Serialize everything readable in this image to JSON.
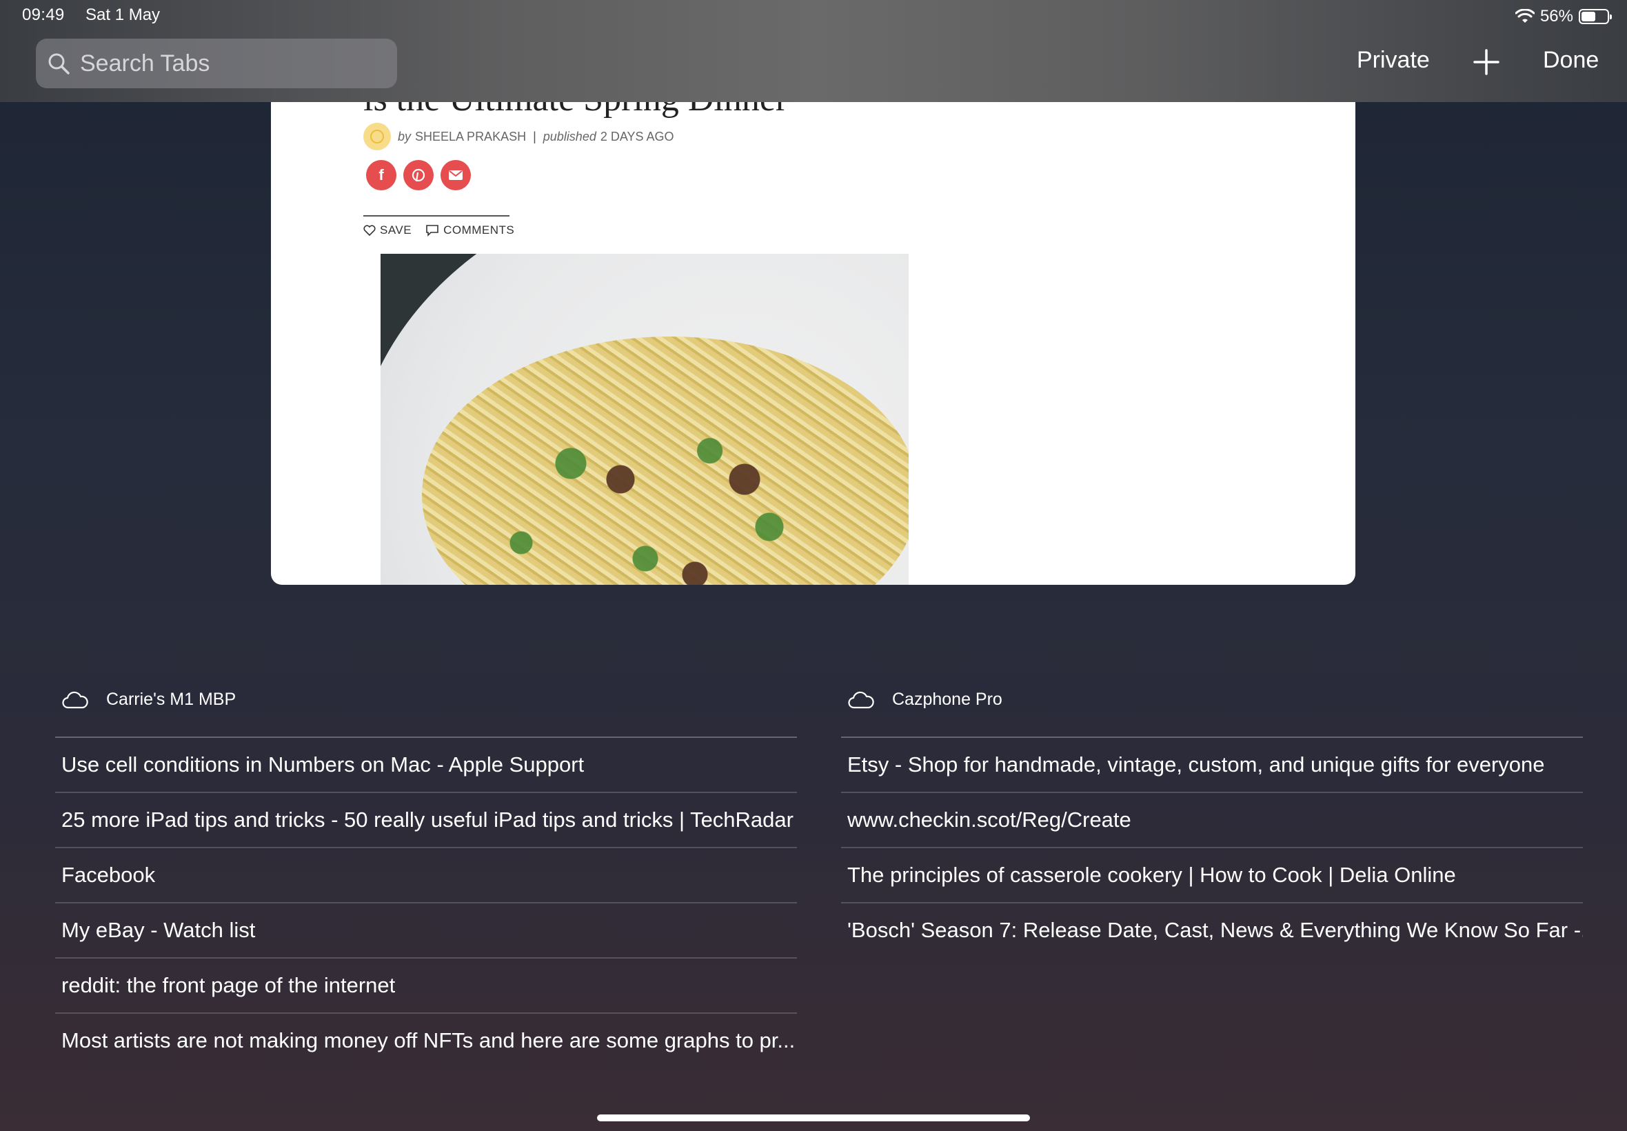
{
  "status_bar": {
    "time": "09:49",
    "date": "Sat 1 May",
    "battery_percent": "56%",
    "battery_level": 0.56
  },
  "toolbar": {
    "search_placeholder": "Search Tabs",
    "private_label": "Private",
    "done_label": "Done"
  },
  "tab_preview": {
    "headline_fragment": "is the Ultimate Spring Dinner",
    "by_prefix": "by",
    "author": "SHEELA PRAKASH",
    "published_prefix": "published",
    "published": "2 DAYS AGO",
    "save_label": "SAVE",
    "comments_label": "COMMENTS"
  },
  "devices": [
    {
      "name": "Carrie's M1 MBP",
      "tabs": [
        "Use cell conditions in Numbers on Mac - Apple Support",
        "25 more iPad tips and tricks - 50 really useful iPad tips and tricks | TechRadar",
        "Facebook",
        "My eBay - Watch list",
        "reddit: the front page of the internet",
        "Most artists are not making money off NFTs and here are some graphs to pr..."
      ]
    },
    {
      "name": "Cazphone Pro",
      "tabs": [
        "Etsy - Shop for handmade, vintage, custom, and unique gifts for everyone",
        "www.checkin.scot/Reg/Create",
        "The principles of casserole cookery | How to Cook | Delia Online",
        "'Bosch' Season 7: Release Date, Cast, News & Everything We Know So Far -..."
      ]
    }
  ],
  "colors": {
    "share_red": "#e54d4f",
    "background_top": "#1d2433",
    "background_bottom": "#3a2d35"
  }
}
